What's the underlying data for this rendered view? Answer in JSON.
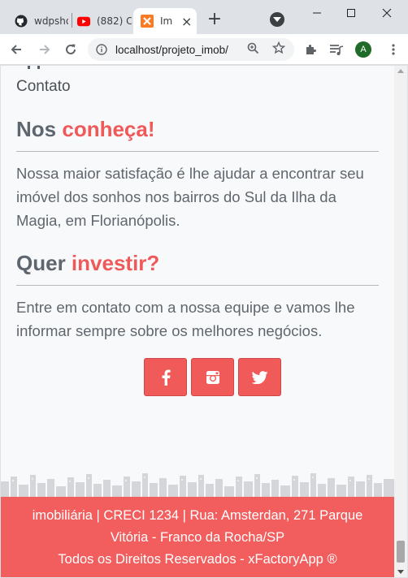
{
  "browser": {
    "tabs": [
      {
        "label": "wdpsho",
        "icon": "github-icon"
      },
      {
        "label": "(882) C",
        "icon": "youtube-icon"
      },
      {
        "label": "Imo",
        "icon": "xampp-icon"
      }
    ],
    "address": "localhost/projeto_imob/",
    "profile_initial": "A"
  },
  "page": {
    "nav_item": "Contato",
    "about": {
      "title_plain": "Nos",
      "title_accent": "conheça!",
      "text": "Nossa maior satisfação é lhe ajudar a encontrar seu imóvel dos sonhos nos bairros do Sul da Ilha da Magia, em Florianópolis."
    },
    "invest": {
      "title_plain": "Quer",
      "title_accent": "investir?",
      "text": "Entre em contato com a nossa equipe e vamos lhe informar sempre sobre os melhores negócios."
    },
    "social": [
      {
        "name": "facebook",
        "icon": "facebook-icon"
      },
      {
        "name": "instagram",
        "icon": "instagram-icon"
      },
      {
        "name": "twitter",
        "icon": "twitter-icon"
      }
    ],
    "footer": {
      "line1": "imobiliária | CRECI 1234 | Rua: Amsterdan, 271 Parque",
      "line2": "Vitória - Franco da Rocha/SP",
      "line3": "Todos os Direitos Reservados - xFactoryApp ®"
    }
  },
  "colors": {
    "accent": "#f0595a",
    "footer": "#f25d5d",
    "text": "#5f666d"
  }
}
